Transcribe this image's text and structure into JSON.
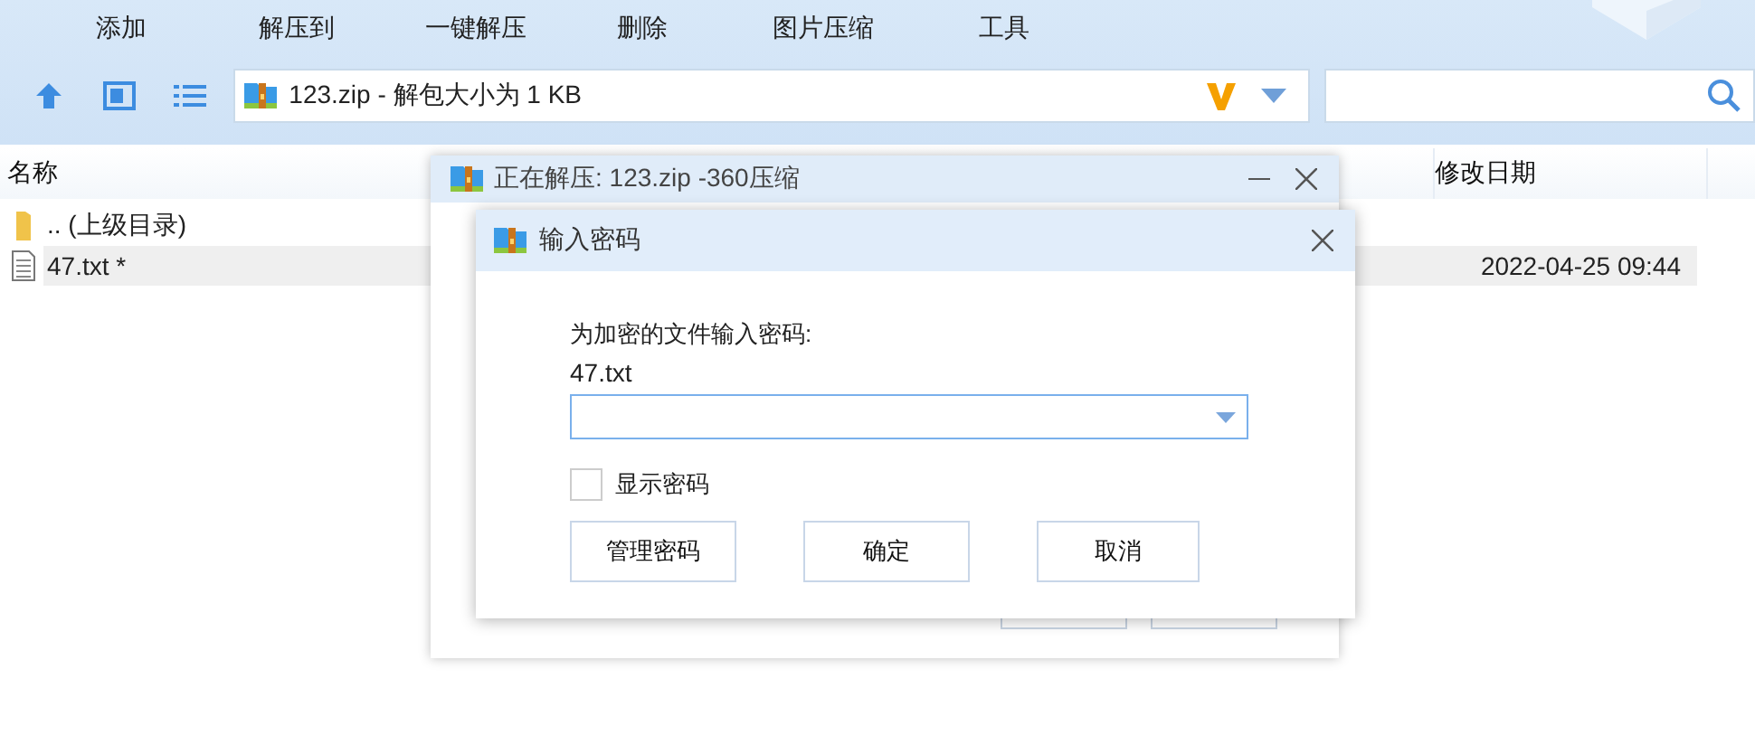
{
  "toolbar": {
    "items": [
      "添加",
      "解压到",
      "一键解压",
      "删除",
      "图片压缩",
      "工具"
    ]
  },
  "address_bar": {
    "path": "123.zip - 解包大小为 1 KB"
  },
  "file_list": {
    "columns": [
      "名称",
      "修改日期"
    ],
    "rows": [
      {
        "kind": "folder",
        "name": ".. (上级目录)",
        "selected": false
      },
      {
        "kind": "file",
        "name": "47.txt *",
        "modified": "2022-04-25 09:44",
        "selected": true
      }
    ]
  },
  "background_window": {
    "title": "正在解压: 123.zip -360压缩"
  },
  "password_dialog": {
    "title": "输入密码",
    "prompt": "为加密的文件输入密码:",
    "file_name": "47.txt",
    "show_password": {
      "label": "显示密码",
      "checked": false
    },
    "buttons": [
      "管理密码",
      "确定",
      "取消"
    ]
  }
}
